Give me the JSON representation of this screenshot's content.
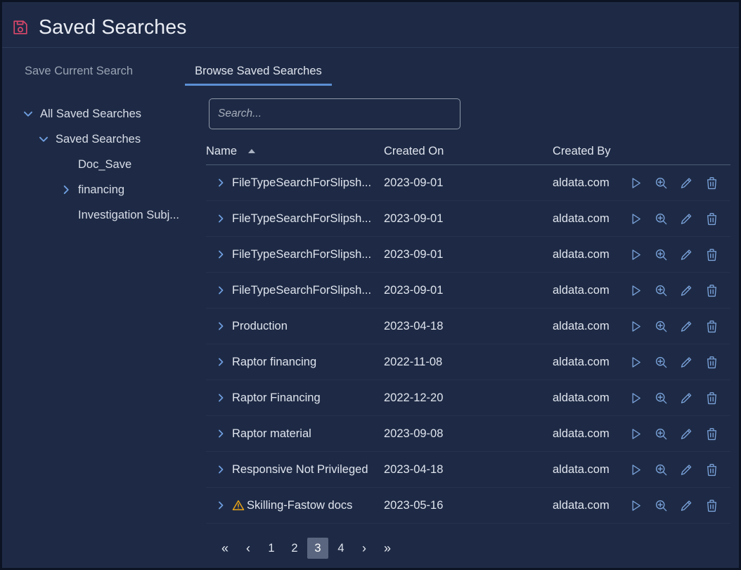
{
  "header": {
    "title": "Saved Searches",
    "icon": "save-floppy-icon",
    "icon_color": "#d9476b"
  },
  "tabs": [
    {
      "label": "Save Current Search",
      "active": false
    },
    {
      "label": "Browse Saved Searches",
      "active": true
    }
  ],
  "tree": [
    {
      "label": "All Saved Searches",
      "level": 0,
      "caret": "chevron-down",
      "expanded": true
    },
    {
      "label": "Saved Searches",
      "level": 1,
      "caret": "chevron-down",
      "expanded": true
    },
    {
      "label": "Doc_Save",
      "level": 2,
      "caret": "none",
      "expanded": false
    },
    {
      "label": "financing",
      "level": 2,
      "caret": "chevron-right",
      "expanded": false
    },
    {
      "label": "Investigation Subj...",
      "level": 2,
      "caret": "none",
      "expanded": false
    }
  ],
  "search": {
    "placeholder": "Search...",
    "value": ""
  },
  "table": {
    "columns": [
      {
        "label": "Name",
        "sort": "asc"
      },
      {
        "label": "Created On",
        "sort": "none"
      },
      {
        "label": "Created By",
        "sort": "none"
      }
    ],
    "rows": [
      {
        "name": "FileTypeSearchForSlipsh...",
        "warning": false,
        "created_on": "2023-09-01",
        "created_by": "aldata.com"
      },
      {
        "name": "FileTypeSearchForSlipsh...",
        "warning": false,
        "created_on": "2023-09-01",
        "created_by": "aldata.com"
      },
      {
        "name": "FileTypeSearchForSlipsh...",
        "warning": false,
        "created_on": "2023-09-01",
        "created_by": "aldata.com"
      },
      {
        "name": "FileTypeSearchForSlipsh...",
        "warning": false,
        "created_on": "2023-09-01",
        "created_by": "aldata.com"
      },
      {
        "name": "Production",
        "warning": false,
        "created_on": "2023-04-18",
        "created_by": "aldata.com"
      },
      {
        "name": "Raptor financing",
        "warning": false,
        "created_on": "2022-11-08",
        "created_by": "aldata.com"
      },
      {
        "name": "Raptor Financing",
        "warning": false,
        "created_on": "2022-12-20",
        "created_by": "aldata.com"
      },
      {
        "name": "Raptor material",
        "warning": false,
        "created_on": "2023-09-08",
        "created_by": "aldata.com"
      },
      {
        "name": "Responsive Not Privileged",
        "warning": false,
        "created_on": "2023-04-18",
        "created_by": "aldata.com"
      },
      {
        "name": "Skilling-Fastow docs",
        "warning": true,
        "created_on": "2023-05-16",
        "created_by": "aldata.com"
      }
    ],
    "row_actions": [
      {
        "name": "run-search-icon",
        "title": "Run"
      },
      {
        "name": "preview-search-icon",
        "title": "Preview"
      },
      {
        "name": "edit-search-icon",
        "title": "Edit"
      },
      {
        "name": "delete-search-icon",
        "title": "Delete"
      }
    ]
  },
  "pagination": {
    "first_label": "«",
    "prev_label": "‹",
    "next_label": "›",
    "last_label": "»",
    "pages": [
      "1",
      "2",
      "3",
      "4"
    ],
    "current": "3"
  },
  "colors": {
    "background": "#1e2a45",
    "accent_blue": "#5b8fd4",
    "icon_blue": "#7ba4dc",
    "warning": "#e8a317",
    "title_icon": "#d9476b",
    "active_page_bg": "#5a667f"
  }
}
